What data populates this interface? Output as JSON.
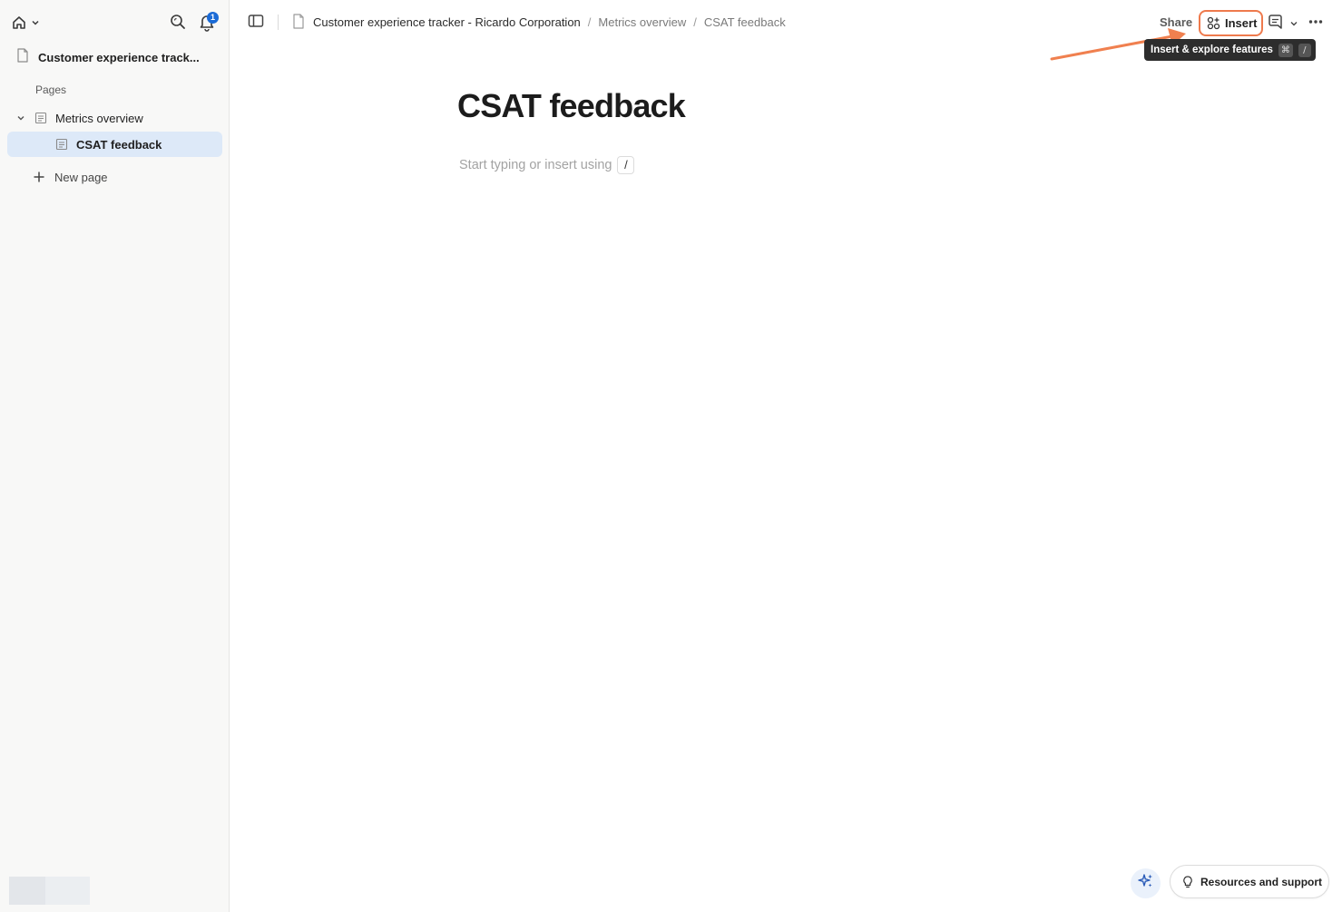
{
  "sidebar": {
    "space_title": "Customer experience track...",
    "notifications_count": "1",
    "pages_label": "Pages",
    "tree": [
      {
        "label": "Metrics overview"
      },
      {
        "label": "CSAT feedback"
      }
    ],
    "new_page_label": "New page"
  },
  "topbar": {
    "breadcrumb": [
      "Customer experience tracker - Ricardo Corporation",
      "Metrics overview",
      "CSAT feedback"
    ],
    "separator": "/",
    "share_label": "Share",
    "insert_label": "Insert",
    "tooltip": {
      "text": "Insert & explore features",
      "shortcut_keys": [
        "⌘",
        "/"
      ]
    }
  },
  "main": {
    "title": "CSAT feedback",
    "placeholder": "Start typing or insert using",
    "placeholder_key": "/"
  },
  "footer": {
    "resources_label": "Resources and support"
  },
  "colors": {
    "accent_highlight": "#ee7a4d",
    "selected_item_bg": "#dde9f8",
    "badge": "#1b6bd6"
  }
}
